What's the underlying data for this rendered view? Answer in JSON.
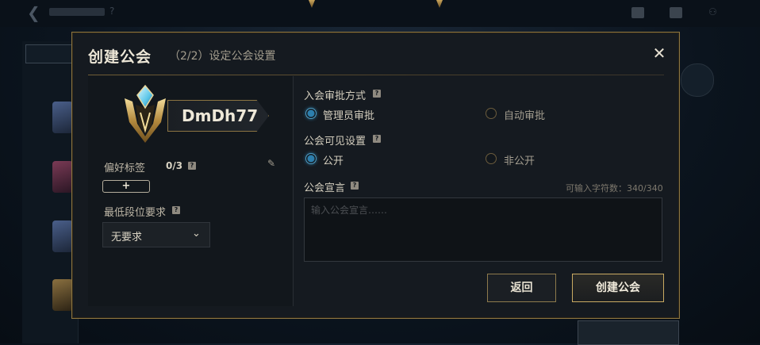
{
  "modal": {
    "title": "创建公会",
    "subtitle": "（2/2）设定公会设置",
    "close_symbol": "✕"
  },
  "profile": {
    "name": "DmDh77",
    "tags_label": "偏好标签",
    "tags_count": "0/3",
    "add_tag_symbol": "+",
    "rank_label": "最低段位要求",
    "rank_value": "无要求"
  },
  "approval": {
    "label": "入会审批方式",
    "options": [
      {
        "label": "管理员审批",
        "selected": true
      },
      {
        "label": "自动审批",
        "selected": false
      }
    ]
  },
  "visibility": {
    "label": "公会可见设置",
    "options": [
      {
        "label": "公开",
        "selected": true
      },
      {
        "label": "非公开",
        "selected": false
      }
    ]
  },
  "declaration": {
    "label": "公会宣言",
    "counter": "可输入字符数：340/340",
    "placeholder": "输入公会宣言……"
  },
  "buttons": {
    "back": "返回",
    "create": "创建公会"
  },
  "icons": {
    "help": "?",
    "edit": "✎",
    "chevron": "⌄"
  },
  "colors": {
    "gold_border": "#8d7641",
    "radio_on": "#2d7fae",
    "modal_bg": "#151a20"
  }
}
